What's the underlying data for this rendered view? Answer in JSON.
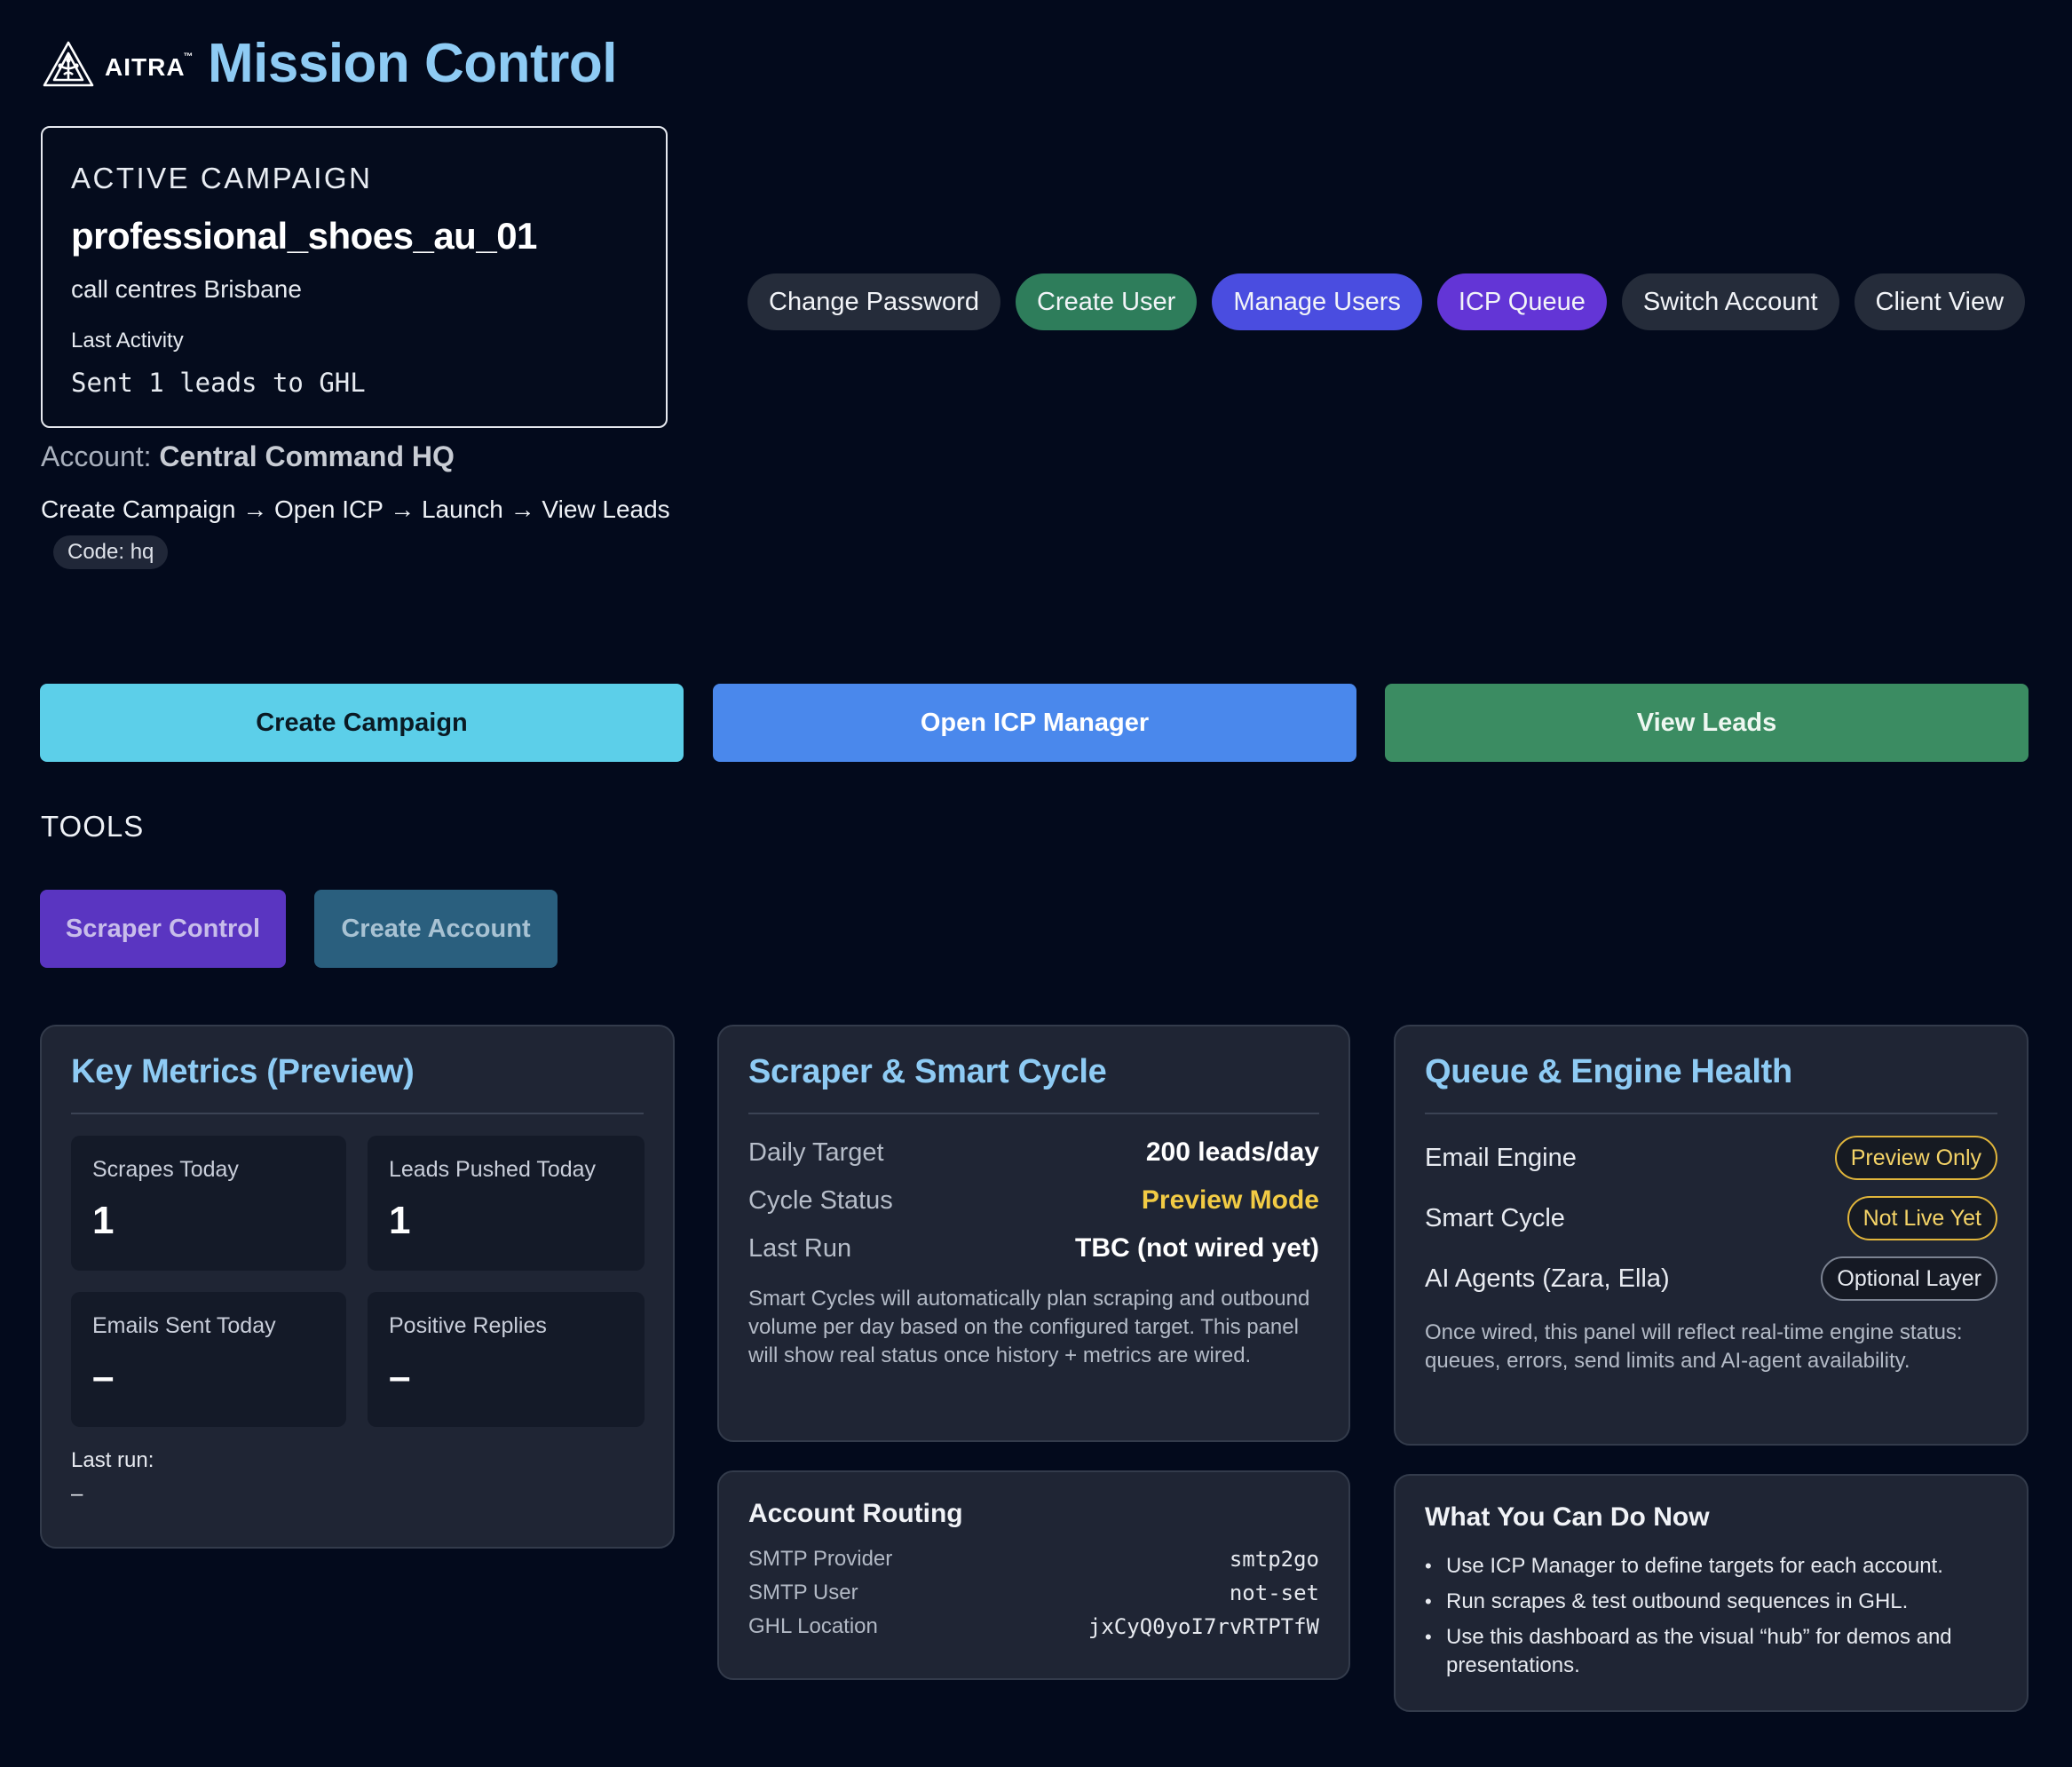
{
  "header": {
    "logo_text": "AITRA",
    "logo_tm": "™",
    "title": "Mission Control"
  },
  "active_campaign": {
    "label": "ACTIVE CAMPAIGN",
    "name": "professional_shoes_au_01",
    "subtitle": "call centres Brisbane",
    "last_activity_label": "Last Activity",
    "last_activity_value": "Sent 1 leads to GHL"
  },
  "account": {
    "prefix": "Account: ",
    "name": "Central Command HQ",
    "flow": "Create Campaign → Open ICP → Launch → View Leads",
    "code": "Code: hq"
  },
  "nav": [
    {
      "label": "Change Password",
      "style": "gray"
    },
    {
      "label": "Create User",
      "style": "green"
    },
    {
      "label": "Manage Users",
      "style": "indigo"
    },
    {
      "label": "ICP Queue",
      "style": "violet"
    },
    {
      "label": "Switch Account",
      "style": "gray"
    },
    {
      "label": "Client View",
      "style": "gray"
    }
  ],
  "actions": {
    "create_campaign": "Create Campaign",
    "open_icp": "Open ICP Manager",
    "view_leads": "View Leads"
  },
  "tools": {
    "label": "TOOLS",
    "scraper_control": "Scraper Control",
    "create_account": "Create Account"
  },
  "metrics": {
    "title": "Key Metrics (Preview)",
    "tiles": [
      {
        "label": "Scrapes Today",
        "value": "1"
      },
      {
        "label": "Leads Pushed Today",
        "value": "1"
      },
      {
        "label": "Emails Sent Today",
        "value": "–"
      },
      {
        "label": "Positive Replies",
        "value": "–"
      }
    ],
    "last_run_label": "Last run:",
    "last_run_value": "–"
  },
  "scraper": {
    "title": "Scraper & Smart Cycle",
    "rows": [
      {
        "key": "Daily Target",
        "value": "200 leads/day"
      },
      {
        "key": "Cycle Status",
        "value": "Preview Mode"
      },
      {
        "key": "Last Run",
        "value": "TBC (not wired yet)"
      }
    ],
    "note": "Smart Cycles will automatically plan scraping and outbound volume per day based on the configured target. This panel will show real status once history + metrics are wired."
  },
  "queue": {
    "title": "Queue & Engine Health",
    "rows": [
      {
        "key": "Email Engine",
        "badge": "Preview Only"
      },
      {
        "key": "Smart Cycle",
        "badge": "Not Live Yet"
      },
      {
        "key": "AI Agents (Zara, Ella)",
        "badge": "Optional Layer"
      }
    ],
    "note": "Once wired, this panel will reflect real-time engine status: queues, errors, send limits and AI-agent availability."
  },
  "routing": {
    "title": "Account Routing",
    "rows": [
      {
        "key": "SMTP Provider",
        "value": "smtp2go"
      },
      {
        "key": "SMTP User",
        "value": "not-set"
      },
      {
        "key": "GHL Location",
        "value": "jxCyQ0yoI7rvRTPTfW"
      }
    ]
  },
  "whatnow": {
    "title": "What You Can Do Now",
    "items": [
      "Use ICP Manager to define targets for each account.",
      "Run scrapes & test outbound sequences in GHL.",
      "Use this dashboard as the visual “hub” for demos and presentations."
    ]
  },
  "colors": {
    "background": "#030a1c",
    "title_accent": "#8ecbf4",
    "create_campaign": "#5ccfe9",
    "open_icp": "#4a88ec",
    "view_leads": "#3b8c62",
    "status_yellow": "#f2cb44"
  },
  "icons": {
    "logo": "aitra-logo-icon"
  }
}
